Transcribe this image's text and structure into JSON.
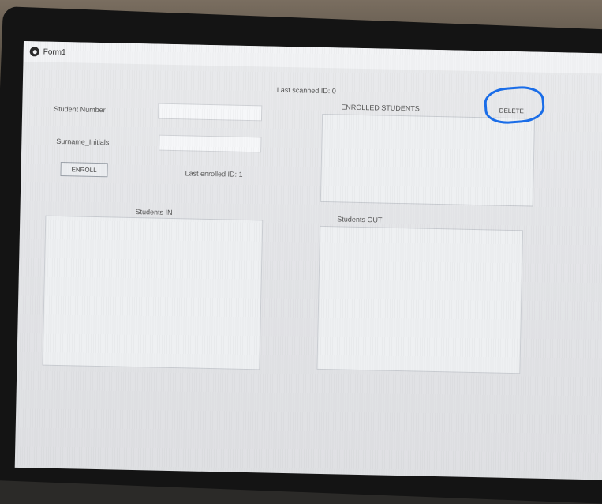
{
  "window": {
    "title": "Form1",
    "icon": "app-icon"
  },
  "status": {
    "last_scanned": "Last scanned ID: 0",
    "last_enrolled": "Last enrolled ID: 1"
  },
  "form": {
    "student_number_label": "Student Number",
    "student_number_value": "",
    "surname_label": "Surname_Initials",
    "surname_value": "",
    "enroll_button": "ENROLL"
  },
  "enrolled": {
    "header": "ENROLLED STUDENTS",
    "delete_button": "DELETE",
    "items": []
  },
  "students_in": {
    "header": "Students IN",
    "items": []
  },
  "students_out": {
    "header": "Students OUT",
    "items": []
  },
  "annotation": {
    "color": "#1a6de8"
  }
}
